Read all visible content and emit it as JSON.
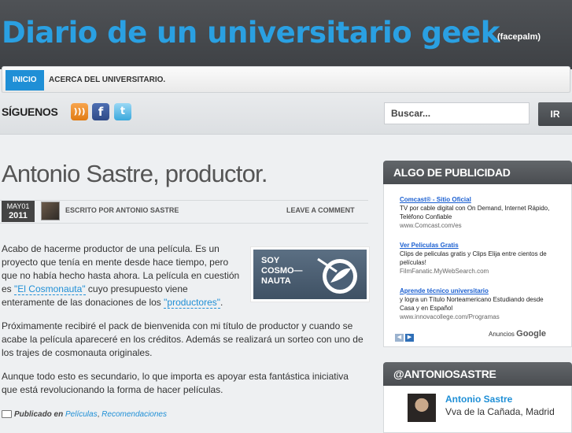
{
  "site": {
    "title": "Diario de un universitario geek",
    "tagline": "(facepalm)"
  },
  "nav": {
    "items": [
      {
        "label": "INICIO"
      },
      {
        "label": "ACERCA DEL UNIVERSITARIO."
      }
    ]
  },
  "follow": {
    "label": "SÍGUENOS",
    "icons": [
      "rss-icon",
      "facebook-icon",
      "twitter-icon"
    ]
  },
  "search": {
    "placeholder": "Buscar...",
    "button": "IR"
  },
  "post": {
    "title": "Antonio Sastre, productor.",
    "date_month": "MAY01",
    "date_year": "2011",
    "author": "ESCRITO POR ANTONIO SASTRE",
    "comment_link": "LEAVE A COMMENT",
    "p1_text_a": "Acabo de hacerme productor de una película. Es un proyecto que tenía en mente desde hace tiempo, pero que no había hecho hasta ahora. La película en cuestión es ",
    "p1_link1": "\"El Cosmonauta\"",
    "p1_text_b": " cuyo presupuesto viene enteramente de las donaciones de los ",
    "p1_link2": "\"productores\"",
    "p1_text_c": ".",
    "p2": "Próximamente recibiré el pack de bienvenida con mi título de productor y cuando se acabe la película apareceré en los créditos. Además se realizará un sorteo con uno de los trajes de cosmonauta originales.",
    "p3": "Aunque todo esto es secundario, lo que importa es apoyar esta fantástica iniciativa que está revolucionando la forma de hacer películas.",
    "image_text": [
      "SOY",
      "COSMO—",
      "NAUTA"
    ],
    "footer_label": "Publicado en",
    "categories": [
      "Películas",
      "Recomendaciones"
    ]
  },
  "sidebar": {
    "ads_title": "ALGO DE PUBLICIDAD",
    "ads": [
      {
        "title": "Comcast® - Sitio Oficial",
        "desc": "TV por cable digital con On Demand, Internet Rápido, Teléfono Confiable",
        "url": "www.Comcast.com/es"
      },
      {
        "title": "Ver Peliculas Gratis",
        "desc": "Clips de peliculas gratis y Clips Elija entre cientos de películas!",
        "url": "FilmFanatic.MyWebSearch.com"
      },
      {
        "title": "Aprende técnico universitario",
        "desc": "y logra un Título Norteamericano Estudiando desde Casa y en Español",
        "url": "www.innovacollege.com/Programas"
      }
    ],
    "ads_label": "Anuncios",
    "ads_brand": "Google",
    "twitter_title": "@ANTONIOSASTRE",
    "twitter_name": "Antonio Sastre",
    "twitter_location": "Vva de la Cañada, Madrid"
  }
}
